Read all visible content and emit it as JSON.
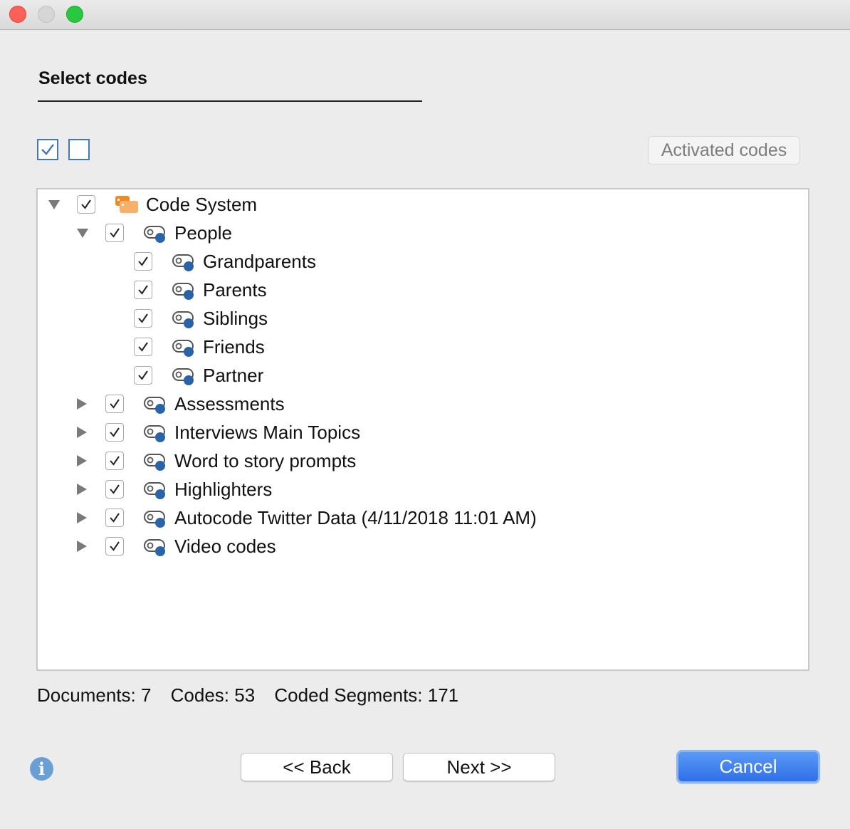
{
  "window": {
    "controls": [
      "close",
      "minimize",
      "zoom"
    ]
  },
  "heading": "Select codes",
  "toolbar": {
    "activated_codes_label": "Activated codes"
  },
  "tree": [
    {
      "label": "Code System",
      "level": 0,
      "expander": "down",
      "checked": true,
      "icon": "code-system-icon"
    },
    {
      "label": "People",
      "level": 1,
      "expander": "down",
      "checked": true,
      "icon": "code-icon"
    },
    {
      "label": "Grandparents",
      "level": 2,
      "expander": "none",
      "checked": true,
      "icon": "code-icon"
    },
    {
      "label": "Parents",
      "level": 2,
      "expander": "none",
      "checked": true,
      "icon": "code-icon"
    },
    {
      "label": "Siblings",
      "level": 2,
      "expander": "none",
      "checked": true,
      "icon": "code-icon"
    },
    {
      "label": "Friends",
      "level": 2,
      "expander": "none",
      "checked": true,
      "icon": "code-icon"
    },
    {
      "label": "Partner",
      "level": 2,
      "expander": "none",
      "checked": true,
      "icon": "code-icon"
    },
    {
      "label": "Assessments",
      "level": 1,
      "expander": "right",
      "checked": true,
      "icon": "code-icon"
    },
    {
      "label": "Interviews Main Topics",
      "level": 1,
      "expander": "right",
      "checked": true,
      "icon": "code-icon"
    },
    {
      "label": "Word to story prompts",
      "level": 1,
      "expander": "right",
      "checked": true,
      "icon": "code-icon"
    },
    {
      "label": "Highlighters",
      "level": 1,
      "expander": "right",
      "checked": true,
      "icon": "code-icon"
    },
    {
      "label": "Autocode Twitter Data (4/11/2018 11:01 AM)",
      "level": 1,
      "expander": "right",
      "checked": true,
      "icon": "code-icon"
    },
    {
      "label": "Video codes",
      "level": 1,
      "expander": "right",
      "checked": true,
      "icon": "code-icon"
    }
  ],
  "stats": {
    "documents": "Documents: 7",
    "codes": "Codes: 53",
    "coded_segments": "Coded Segments: 171"
  },
  "buttons": {
    "back": "<< Back",
    "next": "Next >>",
    "cancel": "Cancel"
  },
  "colors": {
    "accent": "#2f6fe8",
    "code_dot": "#2a64a8",
    "code_system_orange": "#f08a24"
  }
}
